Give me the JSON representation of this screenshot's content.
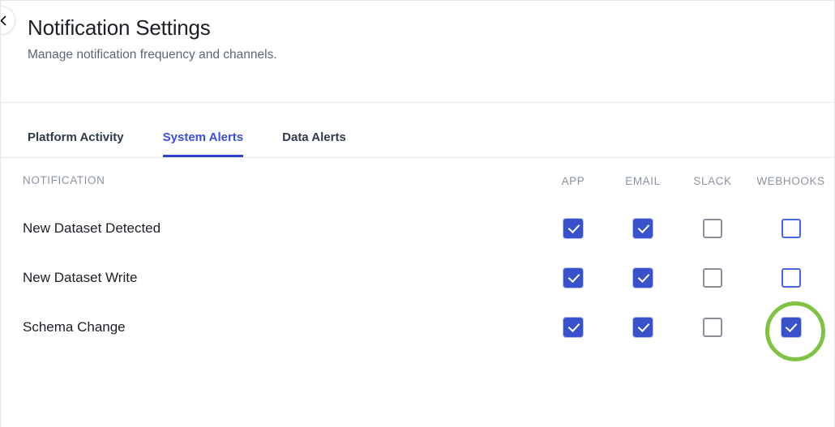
{
  "header": {
    "title": "Notification Settings",
    "subtitle": "Manage notification frequency and channels.",
    "close_icon": "close-icon"
  },
  "tabs": [
    {
      "label": "Platform Activity",
      "active": false
    },
    {
      "label": "System Alerts",
      "active": true
    },
    {
      "label": "Data Alerts",
      "active": false
    }
  ],
  "table": {
    "columns": [
      {
        "key": "notification",
        "label": "NOTIFICATION"
      },
      {
        "key": "app",
        "label": "APP"
      },
      {
        "key": "email",
        "label": "EMAIL"
      },
      {
        "key": "slack",
        "label": "SLACK"
      },
      {
        "key": "webhooks",
        "label": "WEBHOOKS"
      }
    ],
    "rows": [
      {
        "notification": "New Dataset Detected",
        "app": {
          "checked": true,
          "style": "blue"
        },
        "email": {
          "checked": true,
          "style": "blue"
        },
        "slack": {
          "checked": false,
          "style": "gray"
        },
        "webhooks": {
          "checked": false,
          "style": "blue"
        },
        "highlighted": null
      },
      {
        "notification": "New Dataset Write",
        "app": {
          "checked": true,
          "style": "blue"
        },
        "email": {
          "checked": true,
          "style": "blue"
        },
        "slack": {
          "checked": false,
          "style": "gray"
        },
        "webhooks": {
          "checked": false,
          "style": "blue"
        },
        "highlighted": null
      },
      {
        "notification": "Schema Change",
        "app": {
          "checked": true,
          "style": "blue"
        },
        "email": {
          "checked": true,
          "style": "blue"
        },
        "slack": {
          "checked": false,
          "style": "gray"
        },
        "webhooks": {
          "checked": true,
          "style": "blue"
        },
        "highlighted": "webhooks"
      }
    ]
  },
  "colors": {
    "accent_blue": "#3a51cc",
    "tab_active_blue": "#3a4fd8",
    "highlight_green": "#80c342",
    "checkbox_gray_border": "#8a8f99",
    "header_text_gray": "#8b93a1",
    "divider": "#e8eaed"
  }
}
